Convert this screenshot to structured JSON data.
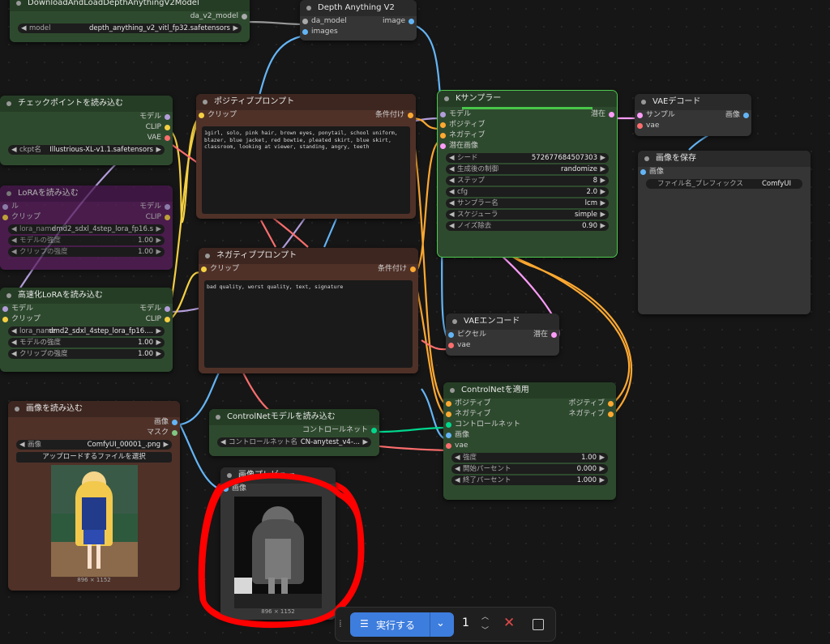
{
  "nodes": {
    "da_loader": {
      "title": "DownloadAndLoadDepthAnythingV2Model",
      "output": "da_v2_model",
      "model_label": "model",
      "model_value": "depth_anything_v2_vitl_fp32.safetensors"
    },
    "depth_anything": {
      "title": "Depth Anything V2",
      "input_model": "da_model",
      "input_images": "images",
      "output": "image"
    },
    "checkpoint": {
      "title": "チェックポイントを読み込む",
      "outputs": [
        "モデル",
        "CLIP",
        "VAE"
      ],
      "ckpt_label": "ckpt名",
      "ckpt_value": "Illustrious-XL-v1.1.safetensors"
    },
    "lora_bypassed": {
      "title": "LoRAを読み込む",
      "inputs": [
        "ル",
        "クリップ"
      ],
      "outputs": [
        "モデル",
        "CLIP"
      ],
      "widgets": [
        {
          "label": "lora_name",
          "value": "dmd2_sdxl_4step_lora_fp16.s"
        },
        {
          "label": "モデルの強度",
          "value": "1.00"
        },
        {
          "label": "クリップの強度",
          "value": "1.00"
        }
      ]
    },
    "lora_fast": {
      "title": "高速化LoRAを読み込む",
      "inputs": [
        "モデル",
        "クリップ"
      ],
      "outputs": [
        "モデル",
        "CLIP"
      ],
      "widgets": [
        {
          "label": "lora_name",
          "value": "dmd2_sdxl_4step_lora_fp16...."
        },
        {
          "label": "モデルの強度",
          "value": "1.00"
        },
        {
          "label": "クリップの強度",
          "value": "1.00"
        }
      ]
    },
    "positive": {
      "title": "ポジティブプロンプト",
      "input": "クリップ",
      "output": "条件付け",
      "text": "1girl, solo, pink hair, brown eyes, ponytail, school uniform, blazer, blue jacket, red bowtie, pleated skirt, blue skirt, classroom, looking at viewer, standing, angry, teeth"
    },
    "negative": {
      "title": "ネガティブプロンプト",
      "input": "クリップ",
      "output": "条件付け",
      "text": "bad quality, worst quality, text, signature"
    },
    "ksampler": {
      "title": "Kサンプラー",
      "inputs": [
        "モデル",
        "ポジティブ",
        "ネガティブ",
        "潜在画像"
      ],
      "output": "潜在",
      "widgets": [
        {
          "label": "シード",
          "value": "572677684507303"
        },
        {
          "label": "生成後の制御",
          "value": "randomize"
        },
        {
          "label": "ステップ",
          "value": "8"
        },
        {
          "label": "cfg",
          "value": "2.0"
        },
        {
          "label": "サンプラー名",
          "value": "lcm"
        },
        {
          "label": "スケジューラ",
          "value": "simple"
        },
        {
          "label": "ノイズ除去",
          "value": "0.90"
        }
      ]
    },
    "vae_decode": {
      "title": "VAEデコード",
      "inputs": [
        "サンプル",
        "vae"
      ],
      "output": "画像"
    },
    "save_image": {
      "title": "画像を保存",
      "input": "画像",
      "prefix_label": "ファイル名_プレフィックス",
      "prefix_value": "ComfyUI"
    },
    "vae_encode": {
      "title": "VAEエンコード",
      "inputs": [
        "ピクセル",
        "vae"
      ],
      "output": "潜在"
    },
    "controlnet_apply": {
      "title": "ControlNetを適用",
      "inputs": [
        "ポジティブ",
        "ネガティブ",
        "コントロールネット",
        "画像",
        "vae"
      ],
      "outputs": [
        "ポジティブ",
        "ネガティブ"
      ],
      "widgets": [
        {
          "label": "強度",
          "value": "1.00"
        },
        {
          "label": "開始パーセント",
          "value": "0.000"
        },
        {
          "label": "終了パーセント",
          "value": "1.000"
        }
      ]
    },
    "load_image": {
      "title": "画像を読み込む",
      "outputs": [
        "画像",
        "マスク"
      ],
      "image_label": "画像",
      "image_value": "ComfyUI_00001_.png",
      "upload_label": "アップロードするファイルを選択",
      "size": "896 × 1152"
    },
    "controlnet_loader": {
      "title": "ControlNetモデルを読み込む",
      "output": "コントロールネット",
      "label": "コントロールネット名",
      "value": "CN-anytest_v4-..."
    },
    "preview": {
      "title": "画像プレビュー",
      "input": "画像",
      "size": "896 × 1152"
    }
  },
  "toolbar": {
    "run_label": "実行する",
    "count": "1"
  },
  "colors": {
    "model": "#b39ddb",
    "clip": "#f5d042",
    "vae": "#ff6e6e",
    "conditioning": "#ffa931",
    "image": "#64b5f6",
    "latent": "#ff9cf9",
    "controlnet": "#00d78d",
    "annotation": "#ff0000"
  }
}
